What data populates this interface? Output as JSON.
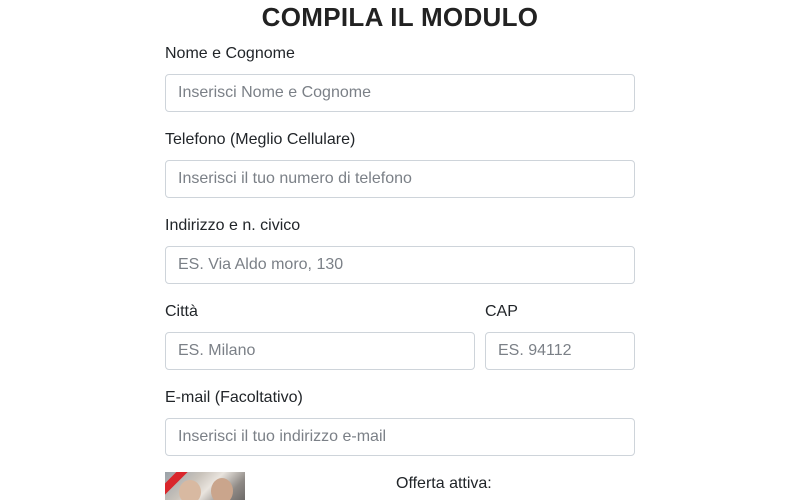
{
  "form": {
    "title": "COMPILA IL MODULO",
    "fields": {
      "name": {
        "label": "Nome e Cognome",
        "placeholder": "Inserisci Nome e Cognome",
        "value": ""
      },
      "phone": {
        "label": "Telefono (Meglio Cellulare)",
        "placeholder": "Inserisci il tuo numero di telefono",
        "value": ""
      },
      "address": {
        "label": "Indirizzo e n. civico",
        "placeholder": "ES. Via Aldo moro, 130",
        "value": ""
      },
      "city": {
        "label": "Città",
        "placeholder": "ES. Milano",
        "value": ""
      },
      "cap": {
        "label": "CAP",
        "placeholder": "ES. 94112",
        "value": ""
      },
      "email": {
        "label": "E-mail (Facoltativo)",
        "placeholder": "Inserisci il tuo indirizzo e-mail",
        "value": ""
      }
    }
  },
  "offer": {
    "label": "Offerta attiva:"
  },
  "colors": {
    "input_border": "#ced4da",
    "ribbon": "#d9262c"
  }
}
